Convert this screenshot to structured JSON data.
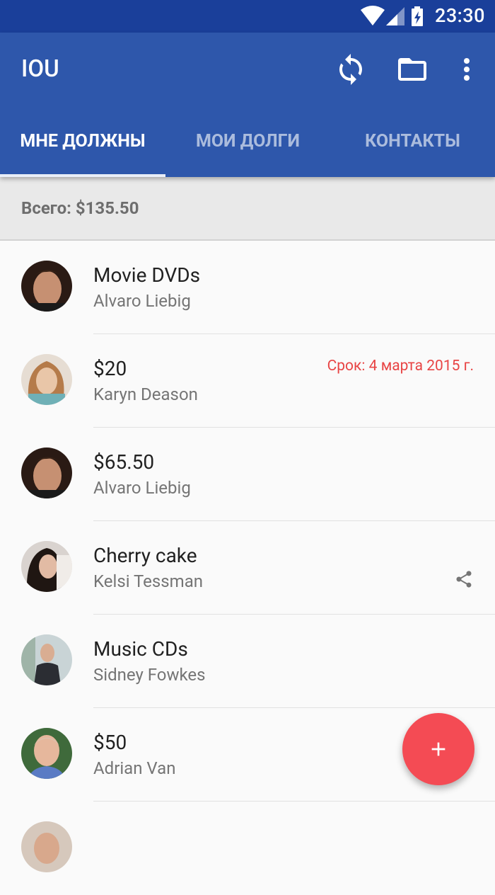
{
  "status_bar": {
    "time": "23:30"
  },
  "app_bar": {
    "title": "IOU"
  },
  "tabs": [
    {
      "label": "МНЕ ДОЛЖНЫ",
      "active": true
    },
    {
      "label": "МОИ ДОЛГИ",
      "active": false
    },
    {
      "label": "КОНТАКТЫ",
      "active": false
    }
  ],
  "summary": {
    "total": "Всего: $135.50"
  },
  "items": [
    {
      "title": "Movie DVDs",
      "person": "Alvaro Liebig"
    },
    {
      "title": "$20",
      "person": "Karyn Deason",
      "due": "Срок: 4 марта 2015 г."
    },
    {
      "title": "$65.50",
      "person": "Alvaro Liebig"
    },
    {
      "title": "Cherry cake",
      "person": "Kelsi Tessman",
      "icon": "share-icon"
    },
    {
      "title": "Music CDs",
      "person": "Sidney Fowkes"
    },
    {
      "title": "$50",
      "person": "Adrian Van"
    }
  ],
  "icons": [
    "wifi-icon",
    "signal-icon",
    "battery-charging-icon",
    "sync-icon",
    "folder-icon",
    "more-vert-icon",
    "share-icon",
    "add-icon"
  ],
  "colors": {
    "primary": "#2e57ab",
    "status_bar": "#1a3f9a",
    "accent": "#f44b54",
    "due_text": "#e84545"
  }
}
